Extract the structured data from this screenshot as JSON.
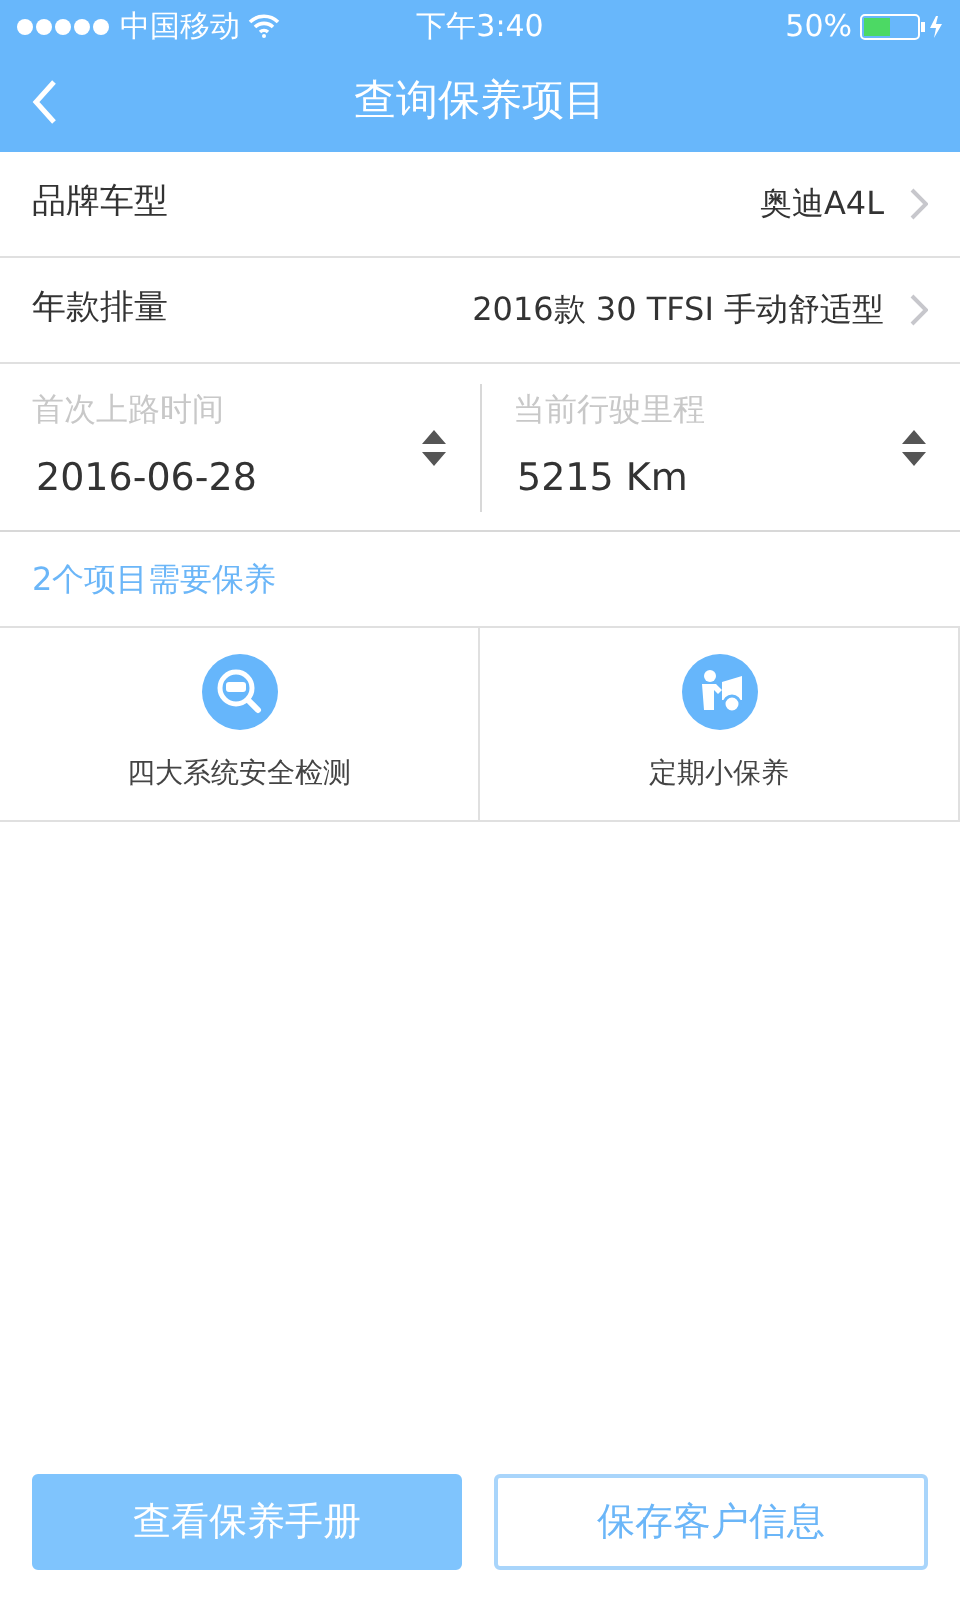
{
  "status_bar": {
    "carrier": "中国移动",
    "time": "下午3:40",
    "battery": "50%"
  },
  "nav": {
    "title": "查询保养项目"
  },
  "rows": [
    {
      "label": "品牌车型",
      "value": "奥迪A4L"
    },
    {
      "label": "年款排量",
      "value": "2016款 30 TFSI 手动舒适型"
    }
  ],
  "pickers": [
    {
      "label": "首次上路时间",
      "value": "2016-06-28"
    },
    {
      "label": "当前行驶里程",
      "value": "5215 Km"
    }
  ],
  "summary": "2个项目需要保养",
  "items": [
    {
      "label": "四大系统安全检测",
      "kind": "inspection"
    },
    {
      "label": "定期小保养",
      "kind": "service"
    }
  ],
  "buttons": [
    {
      "label": "查看保养手册",
      "kind": "primary"
    },
    {
      "label": "保存客户信息",
      "kind": "outline"
    }
  ]
}
